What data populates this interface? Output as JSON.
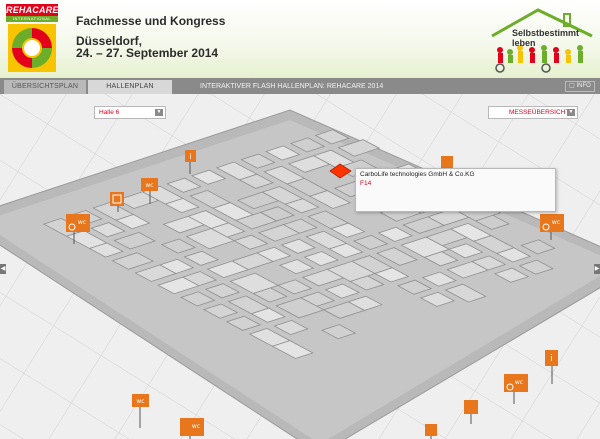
{
  "header": {
    "logo_text": "REHACARE",
    "logo_subtext": "INTERNATIONAL",
    "event_title": "Fachmesse und Kongress",
    "city": "Düsseldorf,",
    "date": "24. – 27. September 2014",
    "slogan": "Selbstbestimmt leben"
  },
  "tabs": {
    "overview": "ÜBERSICHTSPLAN",
    "hall": "HALLENPLAN",
    "title": "INTERAKTIVER FLASH HALLENPLAN: REHACARE 2014",
    "info": "INFO"
  },
  "map": {
    "hall_select": "Halle 6",
    "fair_overview": "MESSEÜBERSICHT",
    "tooltip_company": "CarboLife technologies GmbH & Co.KG",
    "tooltip_stand": "F14"
  },
  "icon_labels": {
    "wc": "wc",
    "info": "i"
  },
  "colors": {
    "brand_red": "#e2001a",
    "brand_green": "#6cae2a",
    "marker_orange": "#e8761c",
    "highlight": "#ff3300"
  }
}
